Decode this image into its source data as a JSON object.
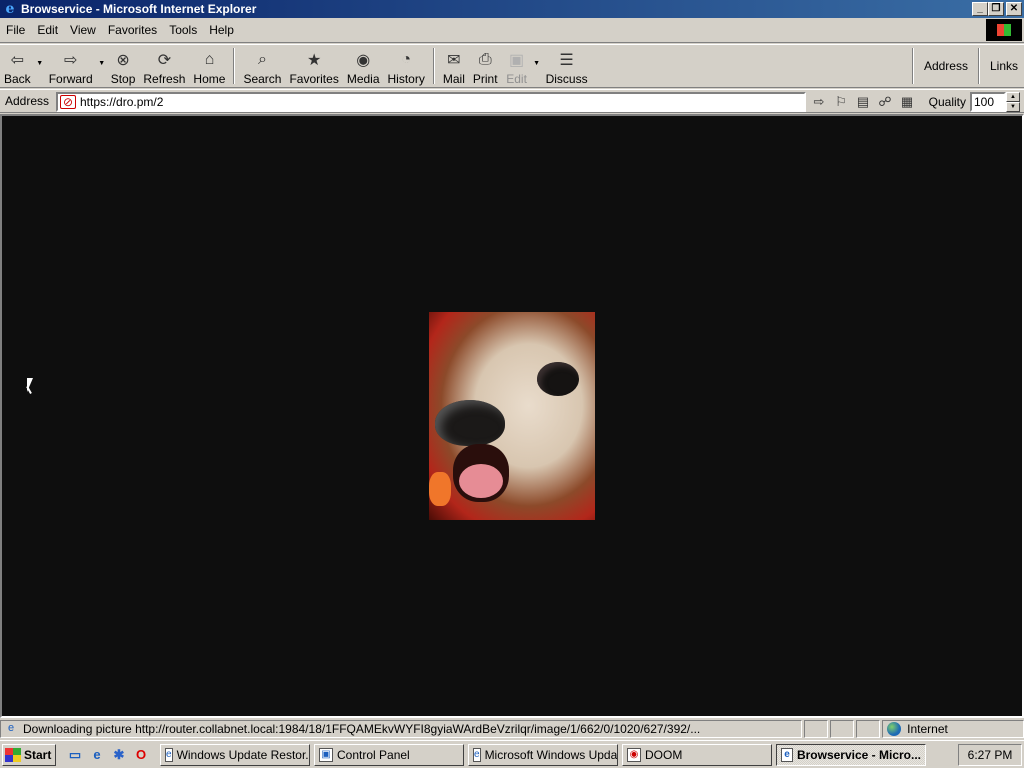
{
  "window": {
    "title": "Browservice - Microsoft Internet Explorer",
    "minimize": "_",
    "restore": "❐",
    "close": "✕"
  },
  "menu": {
    "items": [
      "File",
      "Edit",
      "View",
      "Favorites",
      "Tools",
      "Help"
    ]
  },
  "toolbar": {
    "back": "Back",
    "forward": "Forward",
    "stop": "Stop",
    "refresh": "Refresh",
    "home": "Home",
    "search": "Search",
    "favorites": "Favorites",
    "media": "Media",
    "history": "History",
    "mail": "Mail",
    "print": "Print",
    "edit": "Edit",
    "discuss": "Discuss",
    "address_label": "Address",
    "links_label": "Links"
  },
  "addressbar": {
    "label": "Address",
    "url": "https://dro.pm/2",
    "quality_label": "Quality",
    "quality_value": "100"
  },
  "status": {
    "text": "Downloading picture http://router.collabnet.local:1984/18/1FFQAMEkvWYFI8gyiaWArdBeVzrilqr/image/1/662/0/1020/627/392/...",
    "zone": "Internet"
  },
  "taskbar": {
    "start": "Start",
    "tasks": [
      {
        "label": "Windows Update Restor..."
      },
      {
        "label": "Control Panel"
      },
      {
        "label": "Microsoft Windows Upda..."
      },
      {
        "label": "DOOM"
      },
      {
        "label": "Browservice - Micro..."
      }
    ],
    "clock": "6:27 PM"
  },
  "colors": {
    "title_start": "#0a246a",
    "title_end": "#3a6ea5",
    "content_bg": "#0e0e0e",
    "chrome": "#d4d0c8"
  },
  "icons": [
    "ie-icon",
    "back-icon",
    "forward-icon",
    "stop-icon",
    "refresh-icon",
    "home-icon",
    "search-icon",
    "favorites-icon",
    "media-icon",
    "history-icon",
    "mail-icon",
    "print-icon",
    "edit-icon",
    "discuss-icon",
    "go-arrow-icon",
    "bookmark-icon",
    "globe-icon",
    "windows-logo-icon"
  ]
}
